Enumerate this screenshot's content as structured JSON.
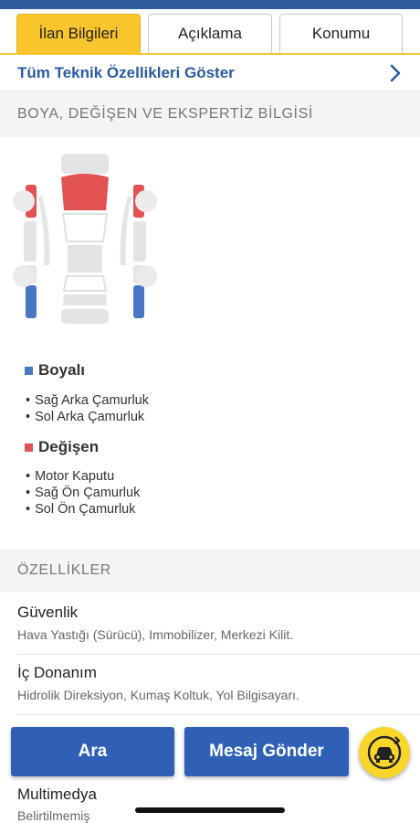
{
  "tabs": [
    {
      "label": "İlan Bilgileri",
      "active": true
    },
    {
      "label": "Açıklama",
      "active": false
    },
    {
      "label": "Konumu",
      "active": false
    }
  ],
  "tech_link": {
    "label": "Tüm Teknik Özellikleri Göster",
    "icon": "chevron-right-icon"
  },
  "paint_section": {
    "title": "BOYA, DEĞİŞEN VE EKSPERTİZ BİLGİSİ",
    "painted": {
      "label": "Boyalı",
      "color": "#4a77c4",
      "items": [
        "Sağ Arka Çamurluk",
        "Sol Arka Çamurluk"
      ]
    },
    "changed": {
      "label": "Değişen",
      "color": "#e25252",
      "items": [
        "Motor Kaputu",
        "Sağ Ön Çamurluk",
        "Sol Ön Çamurluk"
      ]
    }
  },
  "features_section": {
    "title": "ÖZELLİKLER",
    "items": [
      {
        "title": "Güvenlik",
        "text": "Hava Yastığı (Sürücü), Immobilizer, Merkezi Kilit."
      },
      {
        "title": "İç Donanım",
        "text": "Hidrolik Direksiyon, Kumaş Koltuk, Yol Bilgisayarı."
      },
      {
        "title": "Multimedya",
        "text": "Belirtilmemiş"
      }
    ]
  },
  "actions": {
    "call_label": "Ara",
    "message_label": "Mesaj Gönder",
    "fab_icon": "car-rotate-icon"
  },
  "colors": {
    "accent": "#f8c52c",
    "brand_blue": "#2f60b6",
    "link_blue": "#2a5aa3"
  }
}
